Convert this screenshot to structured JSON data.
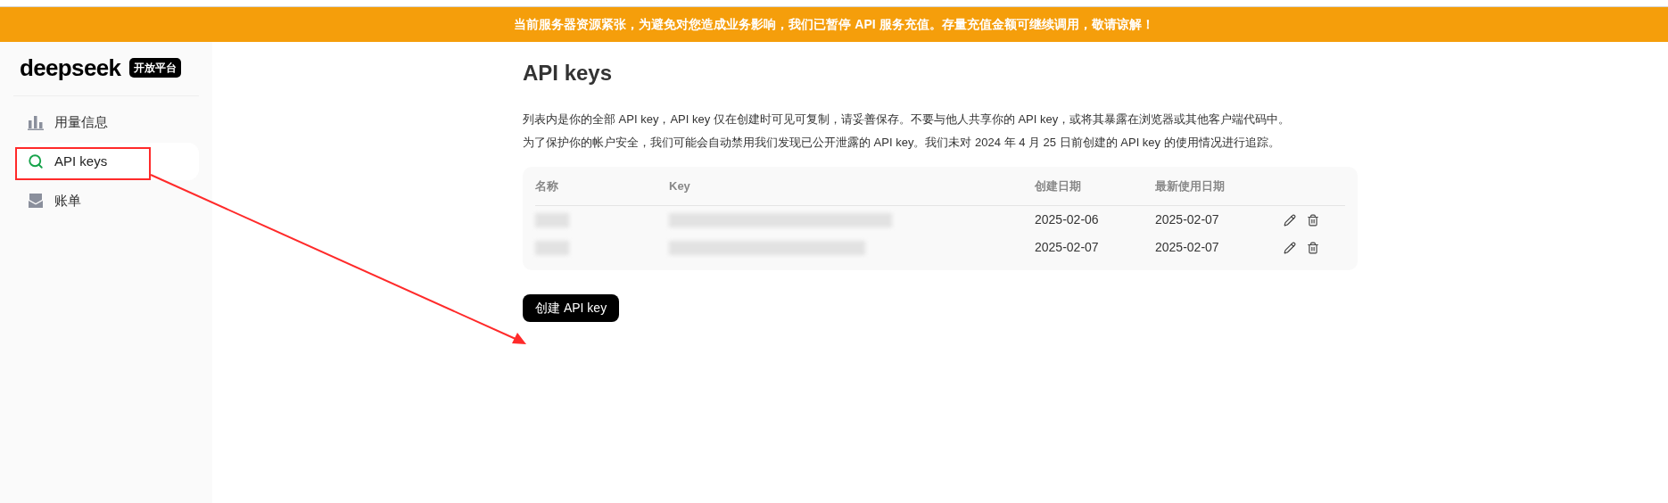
{
  "banner": {
    "text": "当前服务器资源紧张，为避免对您造成业务影响，我们已暂停 API 服务充值。存量充值金额可继续调用，敬请谅解！"
  },
  "sidebar": {
    "logo": "deepseek",
    "badge": "开放平台",
    "items": [
      {
        "label": "用量信息",
        "kind": "usage",
        "selected": false
      },
      {
        "label": "API keys",
        "kind": "keys",
        "selected": true
      },
      {
        "label": "账单",
        "kind": "billing",
        "selected": false
      }
    ]
  },
  "page": {
    "title": "API keys",
    "description": [
      "列表内是你的全部 API key，API key 仅在创建时可见可复制，请妥善保存。不要与他人共享你的 API key，或将其暴露在浏览器或其他客户端代码中。",
      "为了保护你的帐户安全，我们可能会自动禁用我们发现已公开泄露的 API key。我们未对 2024 年 4 月 25 日前创建的 API key 的使用情况进行追踪。"
    ]
  },
  "table": {
    "columns": [
      "名称",
      "Key",
      "创建日期",
      "最新使用日期"
    ],
    "rows": [
      {
        "created": "2025-02-06",
        "last_used": "2025-02-07"
      },
      {
        "created": "2025-02-07",
        "last_used": "2025-02-07"
      }
    ]
  },
  "create_button": "创建 API key"
}
